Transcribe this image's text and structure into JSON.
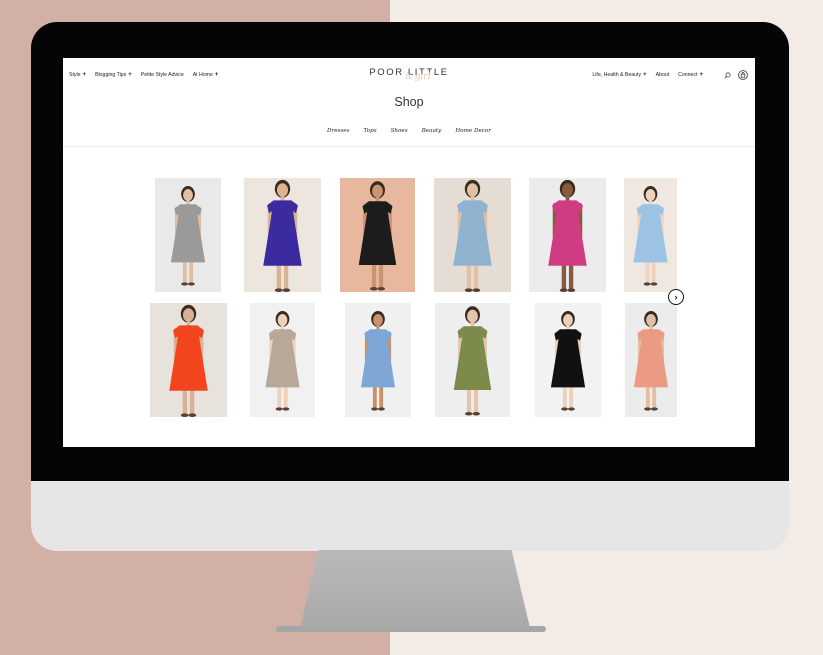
{
  "header": {
    "nav_left": [
      {
        "label": "Style",
        "expandable": true
      },
      {
        "label": "Blogging Tips",
        "expandable": true
      },
      {
        "label": "Petite Style Advice",
        "expandable": false
      },
      {
        "label": "At Home",
        "expandable": true
      }
    ],
    "logo_line1": "POOR LITTLE",
    "logo_line2": "it girl",
    "nav_right": [
      {
        "label": "Life, Health & Beauty",
        "expandable": true
      },
      {
        "label": "About",
        "expandable": false
      },
      {
        "label": "Connect",
        "expandable": true
      }
    ],
    "plus_symbol": "+",
    "icons": [
      "search-icon",
      "bag-icon"
    ]
  },
  "page": {
    "title": "Shop",
    "categories": [
      "Dresses",
      "Tops",
      "Shoes",
      "Beauty",
      "Home Decor"
    ]
  },
  "carousel": {
    "next_symbol": "›",
    "rows": [
      [
        {
          "name": "gray-floral-smocked-midi-dress",
          "bg": "#e9e9e9",
          "dress": "#9a9a9a",
          "skin": "#e2bfa4"
        },
        {
          "name": "purple-tiered-maxi-dress",
          "bg": "#ece6df",
          "dress": "#3b2aa0",
          "skin": "#d9b394"
        },
        {
          "name": "black-mini-shirt-dress",
          "bg": "#e8b89e",
          "dress": "#1c1c1c",
          "skin": "#c99572"
        },
        {
          "name": "chambray-shirt-dress",
          "bg": "#e5ddd3",
          "dress": "#8fb3cf",
          "skin": "#e0c1a5"
        },
        {
          "name": "pink-embroidered-tunic-dress",
          "bg": "#ececec",
          "dress": "#d13b82",
          "skin": "#8a5a3c"
        },
        {
          "name": "light-blue-bell-sleeve-dress",
          "bg": "#efe8e0",
          "dress": "#9cc3e4",
          "skin": "#f0d3bd"
        }
      ],
      [
        {
          "name": "red-orange-flounce-dress",
          "bg": "#e8e2dc",
          "dress": "#f2441d",
          "skin": "#d8b196"
        },
        {
          "name": "taupe-sweater-dress-with-bow",
          "bg": "#f1f1f1",
          "dress": "#b7a898",
          "skin": "#efd1bb"
        },
        {
          "name": "blue-wrap-mini-dress",
          "bg": "#f0f0f0",
          "dress": "#7ea7d6",
          "skin": "#c8916a"
        },
        {
          "name": "olive-knit-midi-dress",
          "bg": "#eeeeee",
          "dress": "#7c8a4c",
          "skin": "#e4c5ab"
        },
        {
          "name": "black-sweater-white-hem-dress",
          "bg": "#f2f2f2",
          "dress": "#111111",
          "skin": "#edd0ba"
        },
        {
          "name": "peach-floral-slip-dress",
          "bg": "#ececec",
          "dress": "#eb9b82",
          "skin": "#e0bfa3"
        }
      ]
    ]
  },
  "colors": {
    "background_left": "#d2b0a5",
    "background_right": "#f3ebe6",
    "logo_accent": "#e8c3ad"
  }
}
